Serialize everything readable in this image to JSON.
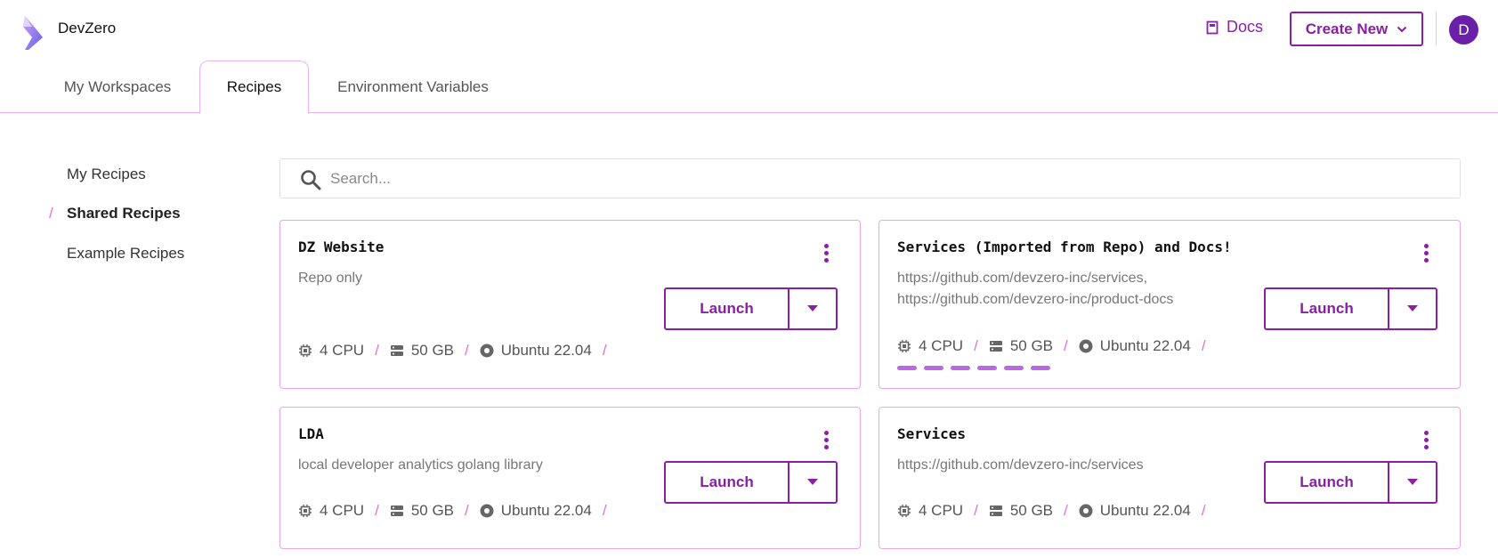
{
  "app": {
    "brand": "DevZero",
    "avatar_initial": "D",
    "accent_color": "#8a1fa4"
  },
  "header": {
    "docs_label": "Docs",
    "create_label": "Create New"
  },
  "tabs": [
    {
      "label": "My Workspaces",
      "active": false
    },
    {
      "label": "Recipes",
      "active": true
    },
    {
      "label": "Environment Variables",
      "active": false
    }
  ],
  "sidebar": {
    "items": [
      {
        "label": "My Recipes",
        "active": false
      },
      {
        "label": "Shared Recipes",
        "active": true
      },
      {
        "label": "Example Recipes",
        "active": false
      }
    ],
    "active_marker": "/"
  },
  "search": {
    "placeholder": "Search...",
    "value": ""
  },
  "recipes": [
    {
      "title": "DZ Website",
      "description": "Repo only",
      "cpu": "4 CPU",
      "storage": "50 GB",
      "os": "Ubuntu 22.04",
      "launch_label": "Launch"
    },
    {
      "title": "Services (Imported from Repo) and Docs!",
      "description": "https://github.com/devzero-inc/services,\nhttps://github.com/devzero-inc/product-docs",
      "cpu": "4 CPU",
      "storage": "50 GB",
      "os": "Ubuntu 22.04",
      "launch_label": "Launch",
      "loading": true
    },
    {
      "title": "LDA",
      "description": "local developer analytics golang library",
      "cpu": "4 CPU",
      "storage": "50 GB",
      "os": "Ubuntu 22.04",
      "launch_label": "Launch"
    },
    {
      "title": "Services",
      "description": "https://github.com/devzero-inc/services",
      "cpu": "4 CPU",
      "storage": "50 GB",
      "os": "Ubuntu 22.04",
      "launch_label": "Launch"
    }
  ],
  "spec_separator": "/"
}
